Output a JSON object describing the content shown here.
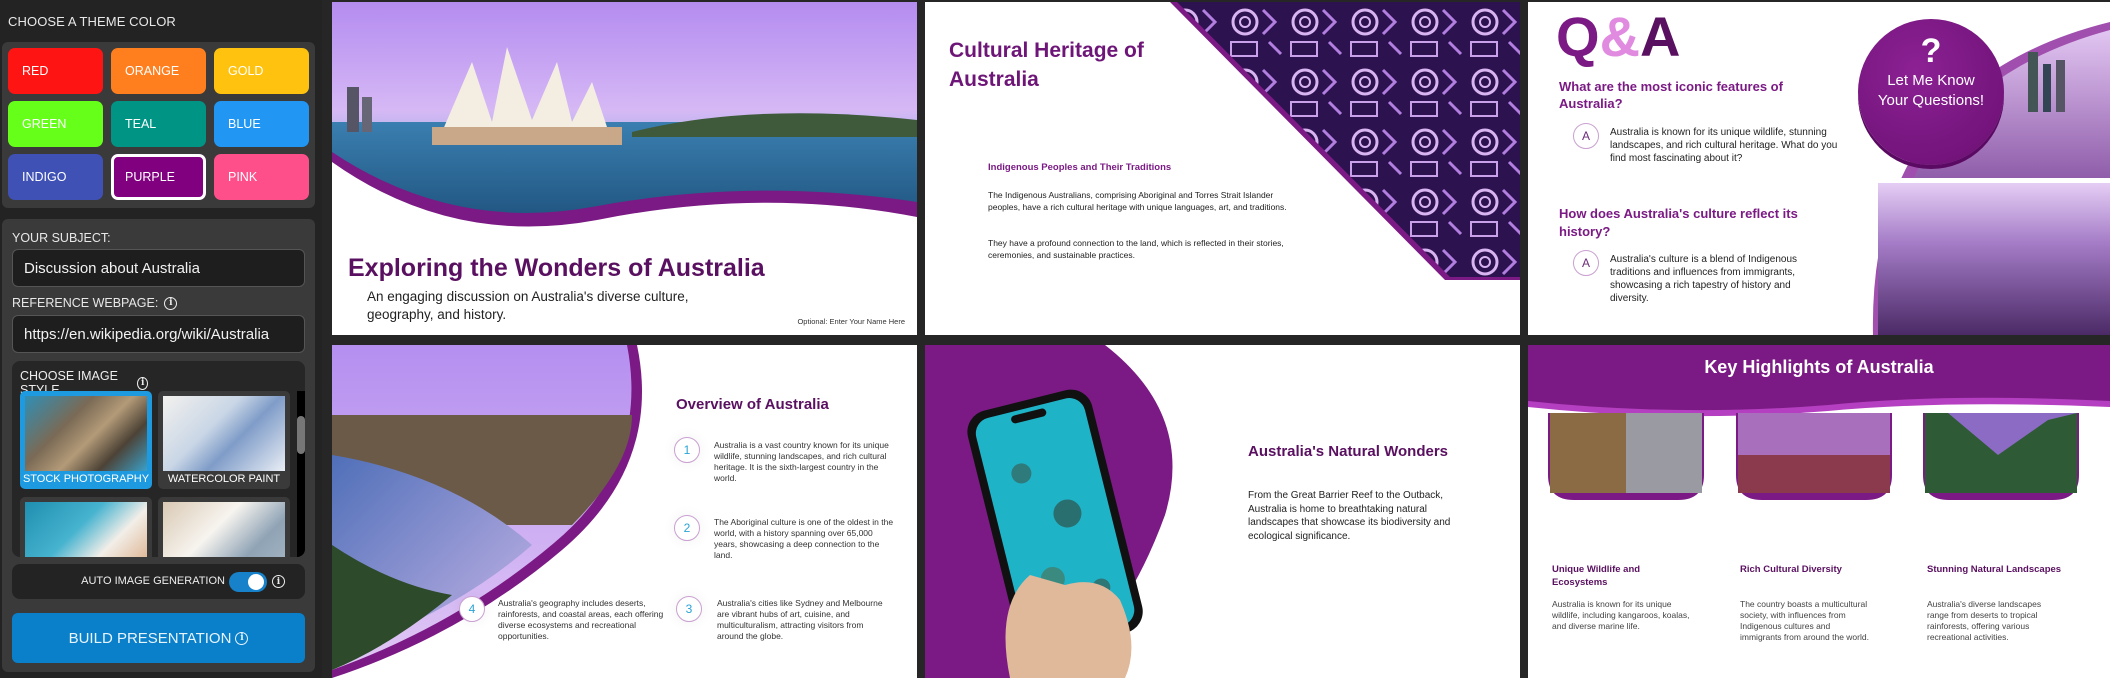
{
  "sidebar": {
    "theme_title": "CHOOSE A THEME COLOR",
    "themes": [
      {
        "label": "RED",
        "color": "#ff1414"
      },
      {
        "label": "ORANGE",
        "color": "#ff7f1f"
      },
      {
        "label": "GOLD",
        "color": "#ffc20f"
      },
      {
        "label": "GREEN",
        "color": "#66ff1a"
      },
      {
        "label": "TEAL",
        "color": "#009485"
      },
      {
        "label": "BLUE",
        "color": "#2196f3"
      },
      {
        "label": "INDIGO",
        "color": "#3f51b5"
      },
      {
        "label": "PURPLE",
        "color": "#800080",
        "selected": true
      },
      {
        "label": "PINK",
        "color": "#ff4f8b"
      }
    ],
    "subject_label": "YOUR SUBJECT:",
    "subject_value": "Discussion about Australia",
    "reference_label": "REFERENCE WEBPAGE:",
    "reference_value": "https://en.wikipedia.org/wiki/Australia",
    "image_style_title": "CHOOSE IMAGE STYLE",
    "image_styles": [
      {
        "label": "STOCK PHOTOGRAPHY",
        "selected": true
      },
      {
        "label": "WATERCOLOR PAINT",
        "selected": false
      },
      {
        "label": "",
        "selected": false
      },
      {
        "label": "",
        "selected": false
      }
    ],
    "auto_image_label": "AUTO IMAGE GENERATION",
    "auto_image_on": true,
    "build_label": "BUILD PRESENTATION",
    "accent": "#0a7fca"
  },
  "slides": {
    "title_slide": {
      "title": "Exploring the Wonders of Australia",
      "subtitle": "An engaging discussion on Australia's diverse culture, geography, and history.",
      "presenter": "Optional: Enter Your Name Here"
    },
    "heritage": {
      "title": "Cultural Heritage of Australia",
      "subheading": "Indigenous Peoples and Their Traditions",
      "para1": "The Indigenous Australians, comprising Aboriginal and Torres Strait Islander peoples, have a rich cultural heritage with unique languages, art, and traditions.",
      "para2": "They have a profound connection to the land, which is reflected in their stories, ceremonies, and sustainable practices."
    },
    "qa": {
      "title_q": "Q",
      "title_amp": "&",
      "title_a": "A",
      "q1": "What are the most iconic features of Australia?",
      "a1": "Australia is known for its unique wildlife, stunning landscapes, and rich cultural heritage. What do you find most fascinating about it?",
      "q2": "How does Australia's culture reflect its history?",
      "a2": "Australia's culture is a blend of Indigenous traditions and influences from immigrants, showcasing a rich tapestry of history and diversity.",
      "answer_marker": "A",
      "bubble_mark": "?",
      "bubble_text": "Let Me Know Your Questions!"
    },
    "overview": {
      "title": "Overview of Australia",
      "items": [
        {
          "num": "1",
          "text": "Australia is a vast country known for its unique wildlife, stunning landscapes, and rich cultural heritage. It is the sixth-largest country in the world."
        },
        {
          "num": "2",
          "text": "The Aboriginal culture is one of the oldest in the world, with a history spanning over 65,000 years, showcasing a deep connection to the land."
        },
        {
          "num": "3",
          "text": "Australia's cities like Sydney and Melbourne are vibrant hubs of art, cuisine, and multiculturalism, attracting visitors from around the globe."
        },
        {
          "num": "4",
          "text": "Australia's geography includes deserts, rainforests, and coastal areas, each offering diverse ecosystems and recreational opportunities."
        }
      ]
    },
    "natural": {
      "title": "Australia's Natural Wonders",
      "body": "From the Great Barrier Reef to the Outback, Australia is home to breathtaking natural landscapes that showcase its biodiversity and ecological significance."
    },
    "highlights": {
      "title": "Key Highlights of Australia",
      "cards": [
        {
          "title": "Unique Wildlife and Ecosystems",
          "text": "Australia is known for its unique wildlife, including kangaroos, koalas, and diverse marine life."
        },
        {
          "title": "Rich Cultural Diversity",
          "text": "The country boasts a multicultural society, with influences from Indigenous cultures and immigrants from around the world."
        },
        {
          "title": "Stunning Natural Landscapes",
          "text": "Australia's diverse landscapes range from deserts to tropical rainforests, offering various recreational activities."
        }
      ]
    }
  }
}
